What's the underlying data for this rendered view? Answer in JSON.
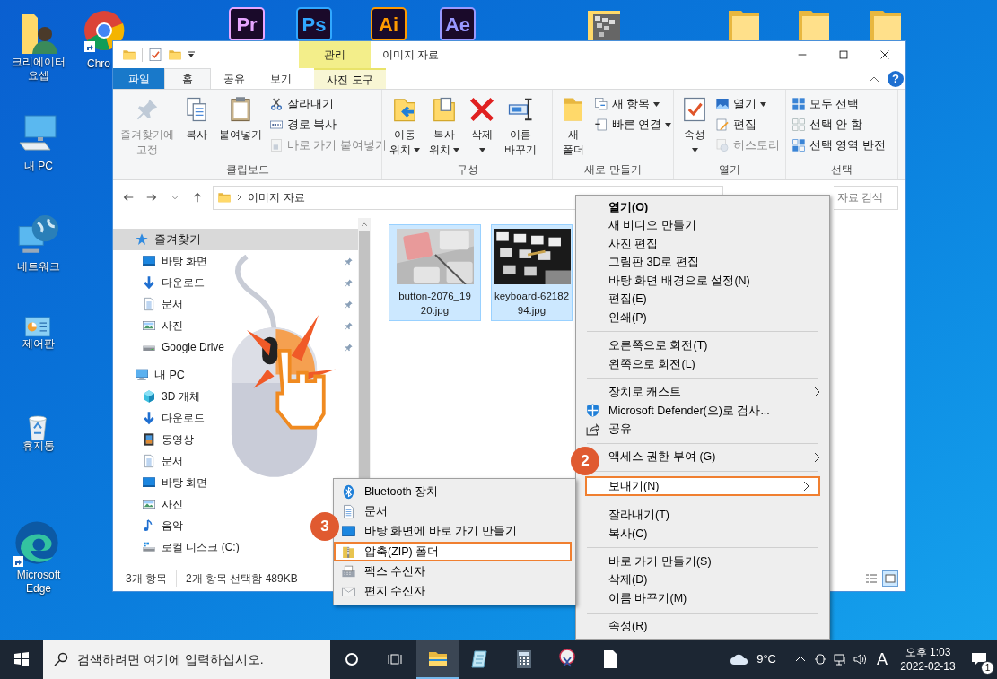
{
  "desktop": {
    "left_icons": [
      {
        "label_lines": [
          "크리에이터",
          "요셉"
        ],
        "kind": "userfolder"
      },
      {
        "label_lines": [
          "내 PC"
        ],
        "kind": "pc"
      },
      {
        "label_lines": [
          "네트워크"
        ],
        "kind": "network"
      },
      {
        "label_lines": [
          "제어판"
        ],
        "kind": "control"
      },
      {
        "label_lines": [
          "휴지통"
        ],
        "kind": "recycle"
      },
      {
        "label_lines": [
          "Microsoft",
          "Edge"
        ],
        "kind": "edge"
      },
      {
        "label_lines": [
          "Chro"
        ],
        "kind": "chrome"
      }
    ],
    "top_icons": [
      {
        "kind": "app",
        "glyph": "Pr",
        "color": "#e7a6ff"
      },
      {
        "kind": "app",
        "glyph": "Ps",
        "color": "#31a8ff"
      },
      {
        "kind": "app",
        "glyph": "Ai",
        "color": "#ff9a00"
      },
      {
        "kind": "app",
        "glyph": "Ae",
        "color": "#9999ff"
      },
      {
        "kind": "thumb"
      },
      {
        "kind": "folder"
      },
      {
        "kind": "folder"
      },
      {
        "kind": "folder"
      }
    ]
  },
  "window": {
    "title": "이미지 자료",
    "context_tab": "관리",
    "tabs": [
      {
        "label": "파일",
        "kind": "file",
        "selected": false
      },
      {
        "label": "홈",
        "kind": "tab",
        "selected": true
      },
      {
        "label": "공유",
        "kind": "tab",
        "selected": false
      },
      {
        "label": "보기",
        "kind": "tab",
        "selected": false
      },
      {
        "label": "사진 도구",
        "kind": "context",
        "selected": false
      }
    ],
    "help": "?",
    "ribbon": [
      {
        "label": "클립보드",
        "buttons": [
          {
            "kind": "large",
            "lines": [
              "즐겨찾기에",
              "고정"
            ],
            "disabled": true
          },
          {
            "kind": "large",
            "lines": [
              "복사"
            ],
            "disabled": false
          },
          {
            "kind": "large",
            "lines": [
              "붙여넣기"
            ],
            "disabled": false
          },
          {
            "kind": "small",
            "lines": [
              "잘라내기"
            ],
            "disabled": false
          },
          {
            "kind": "small",
            "lines": [
              "경로 복사"
            ],
            "disabled": false
          },
          {
            "kind": "small",
            "lines": [
              "바로 가기 붙여넣기"
            ],
            "disabled": true
          }
        ]
      },
      {
        "label": "구성",
        "buttons": [
          {
            "kind": "large",
            "lines": [
              "이동",
              "위치"
            ],
            "dropdown": true,
            "disabled": false
          },
          {
            "kind": "large",
            "lines": [
              "복사",
              "위치"
            ],
            "dropdown": true,
            "disabled": false
          },
          {
            "kind": "large",
            "lines": [
              "삭제"
            ],
            "dropdown": true,
            "disabled": false
          },
          {
            "kind": "large",
            "lines": [
              "이름",
              "바꾸기"
            ],
            "disabled": false
          }
        ]
      },
      {
        "label": "새로 만들기",
        "buttons": [
          {
            "kind": "large",
            "lines": [
              "새",
              "폴더"
            ],
            "disabled": false
          },
          {
            "kind": "small",
            "lines": [
              "새 항목"
            ],
            "dropdown": true,
            "disabled": false
          },
          {
            "kind": "small",
            "lines": [
              "빠른 연결"
            ],
            "dropdown": true,
            "disabled": false
          }
        ]
      },
      {
        "label": "열기",
        "buttons": [
          {
            "kind": "large",
            "lines": [
              "속성"
            ],
            "dropdown": true,
            "disabled": false
          },
          {
            "kind": "small",
            "lines": [
              "열기"
            ],
            "dropdown": true,
            "disabled": false
          },
          {
            "kind": "small",
            "lines": [
              "편집"
            ],
            "disabled": false
          },
          {
            "kind": "small",
            "lines": [
              "히스토리"
            ],
            "disabled": true
          }
        ]
      },
      {
        "label": "선택",
        "buttons": [
          {
            "kind": "small",
            "lines": [
              "모두 선택"
            ],
            "disabled": false
          },
          {
            "kind": "small",
            "lines": [
              "선택 안 함"
            ],
            "disabled": false
          },
          {
            "kind": "small",
            "lines": [
              "선택 영역 반전"
            ],
            "disabled": false
          }
        ]
      }
    ],
    "address": "이미지 자료",
    "search": {
      "placeholder": "자료 검색"
    },
    "nav": [
      {
        "label": "즐겨찾기",
        "selected": true,
        "children": [
          {
            "label": "바탕 화면",
            "pinned": true,
            "selected": false
          },
          {
            "label": "다운로드",
            "pinned": true,
            "selected": false
          },
          {
            "label": "문서",
            "pinned": true,
            "selected": false
          },
          {
            "label": "사진",
            "pinned": true,
            "selected": false
          },
          {
            "label": "Google Drive",
            "pinned": true,
            "selected": false
          }
        ]
      },
      {
        "label": "내 PC",
        "selected": false,
        "children": [
          {
            "label": "3D 개체",
            "selected": false
          },
          {
            "label": "다운로드",
            "selected": false
          },
          {
            "label": "동영상",
            "selected": false
          },
          {
            "label": "문서",
            "selected": false
          },
          {
            "label": "바탕 화면",
            "selected": false
          },
          {
            "label": "사진",
            "selected": false
          },
          {
            "label": "음악",
            "selected": false
          },
          {
            "label": "로컬 디스크 (C:)",
            "selected": false
          }
        ]
      }
    ],
    "files": [
      {
        "name_lines": [
          "button-2076_19",
          "20.jpg"
        ],
        "kind": "picture",
        "selected": true
      },
      {
        "name_lines": [
          "keyboard-62182",
          "94.jpg"
        ],
        "kind": "picture",
        "selected": true
      }
    ],
    "status": [
      "3개 항목",
      "2개 항목 선택함 489KB"
    ]
  },
  "context_menu": [
    {
      "kind": "item",
      "label": "열기(O)",
      "bold": true,
      "selected": false
    },
    {
      "kind": "item",
      "label": "새 비디오 만들기",
      "selected": false
    },
    {
      "kind": "item",
      "label": "사진 편집",
      "selected": false
    },
    {
      "kind": "item",
      "label": "그림판 3D로 편집",
      "selected": false
    },
    {
      "kind": "item",
      "label": "바탕 화면 배경으로 설정(N)",
      "selected": false
    },
    {
      "kind": "item",
      "label": "편집(E)",
      "selected": false
    },
    {
      "kind": "item",
      "label": "인쇄(P)",
      "selected": false
    },
    {
      "kind": "separator"
    },
    {
      "kind": "item",
      "label": "오른쪽으로 회전(T)",
      "selected": false
    },
    {
      "kind": "item",
      "label": "왼쪽으로 회전(L)",
      "selected": false
    },
    {
      "kind": "separator"
    },
    {
      "kind": "item",
      "label": "장치로 캐스트",
      "submenu": true,
      "selected": false
    },
    {
      "kind": "item",
      "label": "Microsoft Defender(으)로 검사...",
      "selected": false
    },
    {
      "kind": "item",
      "label": "공유",
      "selected": false
    },
    {
      "kind": "separator"
    },
    {
      "kind": "item",
      "label": "액세스 권한 부여 (G)",
      "submenu": true,
      "selected": false
    },
    {
      "kind": "separator"
    },
    {
      "kind": "item",
      "label": "보내기(N)",
      "submenu": true,
      "selected": true,
      "callout": "2"
    },
    {
      "kind": "separator"
    },
    {
      "kind": "item",
      "label": "잘라내기(T)",
      "selected": false
    },
    {
      "kind": "item",
      "label": "복사(C)",
      "selected": false
    },
    {
      "kind": "separator"
    },
    {
      "kind": "item",
      "label": "바로 가기 만들기(S)",
      "selected": false
    },
    {
      "kind": "item",
      "label": "삭제(D)",
      "selected": false
    },
    {
      "kind": "item",
      "label": "이름 바꾸기(M)",
      "selected": false
    },
    {
      "kind": "separator"
    },
    {
      "kind": "item",
      "label": "속성(R)",
      "selected": false
    }
  ],
  "send_to_menu": [
    {
      "label": "Bluetooth 장치",
      "selected": false
    },
    {
      "label": "문서",
      "selected": false
    },
    {
      "label": "바탕 화면에 바로 가기 만들기",
      "selected": false
    },
    {
      "label": "압축(ZIP) 폴더",
      "selected": true,
      "callout": "3"
    },
    {
      "label": "팩스 수신자",
      "selected": false
    },
    {
      "label": "편지 수신자",
      "selected": false
    }
  ],
  "taskbar": {
    "search": {
      "placeholder": "검색하려면 여기에 입력하십시오."
    },
    "apps": [
      {
        "selected": true
      },
      {
        "selected": false
      },
      {
        "selected": false
      },
      {
        "selected": false
      },
      {
        "selected": false
      }
    ],
    "temperature": "9°C",
    "ime": "A",
    "time": "오후 1:03",
    "date": "2022-02-13",
    "notifications": "1"
  }
}
